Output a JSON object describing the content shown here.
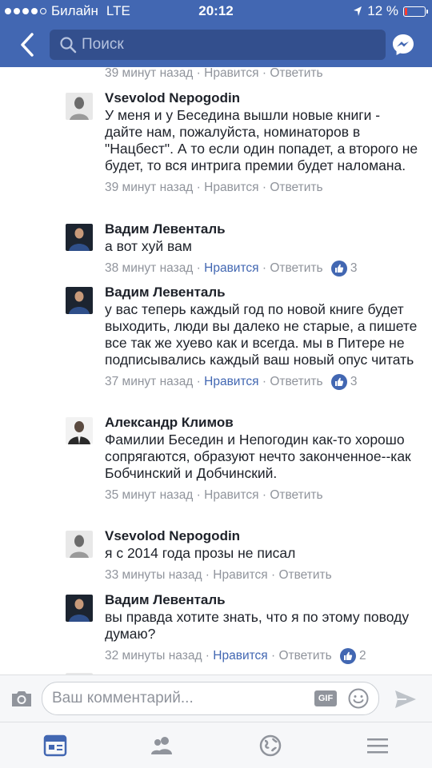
{
  "status": {
    "carrier": "Билайн",
    "network": "LTE",
    "time": "20:12",
    "battery": "12 %"
  },
  "nav": {
    "search_placeholder": "Поиск"
  },
  "colors": {
    "brand": "#4267b2",
    "text": "#1d2129",
    "meta": "#90949c"
  },
  "meta_labels": {
    "like": "Нравится",
    "reply": "Ответить",
    "sep": " · "
  },
  "top_meta": {
    "time": "39 минут назад"
  },
  "comments": [
    {
      "author": "Vsevolod  Nepogodin",
      "text": "У меня и у Беседина вышли новые книги - дайте нам, пожалуйста, номинаторов в \"Нацбест\". А то если один попадет, а второго не будет, то вся интрига премии будет наломана.",
      "time": "39 минут назад",
      "liked": false,
      "reactions": ""
    },
    {
      "author": "Вадим Левенталь",
      "text": "а вот хуй вам",
      "time": "38 минут назад",
      "liked": true,
      "reactions": "3"
    },
    {
      "author": "Вадим Левенталь",
      "text": "у вас теперь каждый год по новой книге будет выходить, люди вы далеко не старые, а пишете все так же хуево как и всегда. мы в Питере не подписывались каждый ваш новый опус читать",
      "time": "37 минут назад",
      "liked": true,
      "reactions": "3"
    },
    {
      "author": "Александр Климов",
      "text": "Фамилии Беседин и Непогодин как-то хорошо сопрягаются, образуют нечто законченное--как Бобчинский и Добчинский.",
      "time": "35 минут назад",
      "liked": false,
      "reactions": ""
    },
    {
      "author": "Vsevolod  Nepogodin",
      "text": "я с 2014 года прозы не писал",
      "time": "33 минуты назад",
      "liked": false,
      "reactions": ""
    },
    {
      "author": "Вадим Левенталь",
      "text": "вы правда хотите знать, что я по этому поводу думаю?",
      "time": "32 минуты назад",
      "liked": true,
      "reactions": "2"
    }
  ],
  "composer": {
    "placeholder": "Ваш комментарий...",
    "gif": "GIF"
  },
  "tabs": [
    "news-feed",
    "friends",
    "notifications",
    "menu"
  ]
}
